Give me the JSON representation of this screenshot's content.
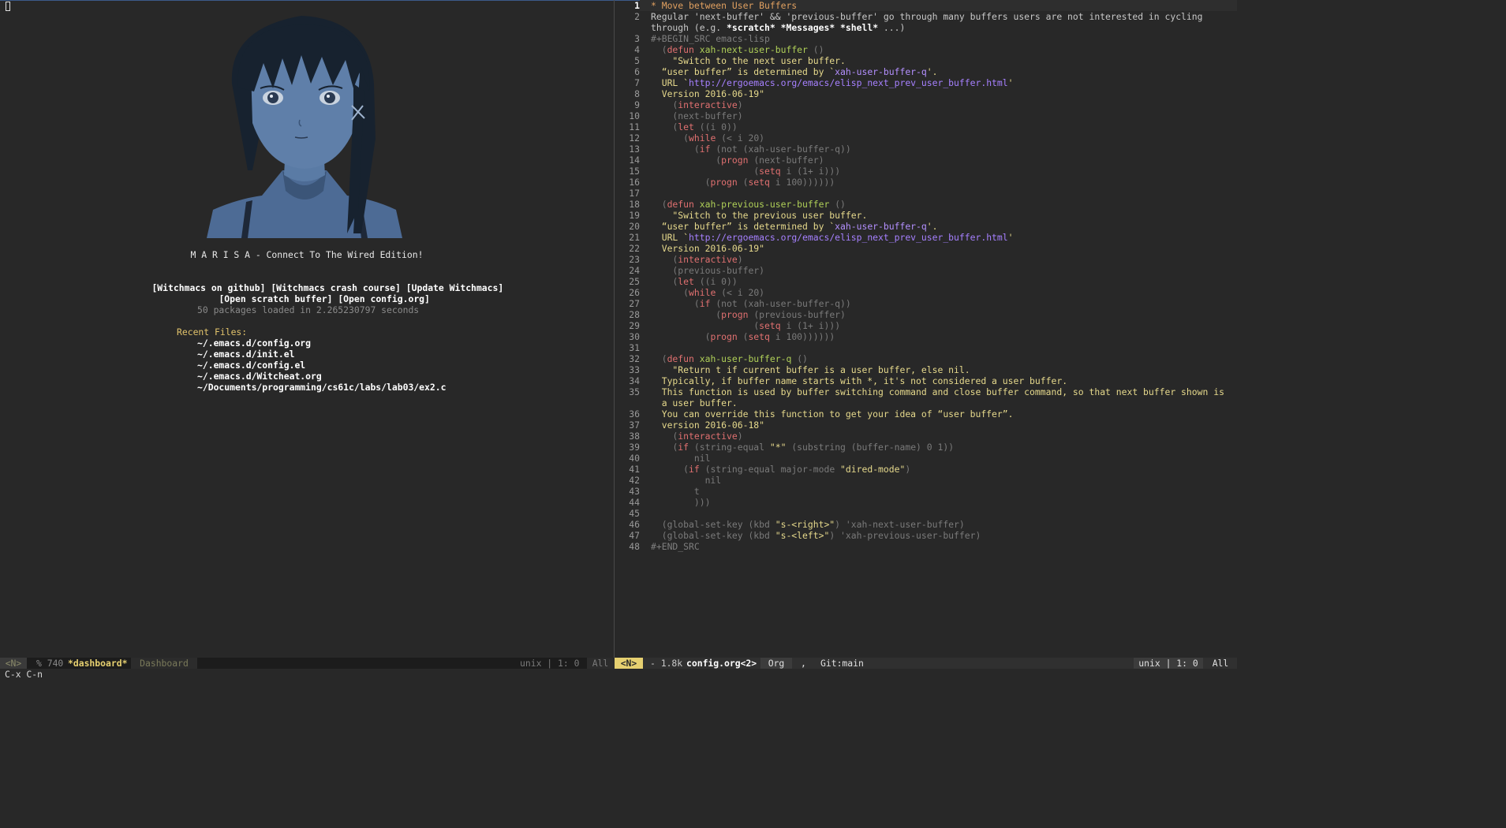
{
  "dashboard": {
    "banner_title": "M A R I S A - Connect To The Wired Edition!",
    "buttons_row1": [
      "[Witchmacs on github]",
      "[Witchmacs crash course]",
      "[Update Witchmacs]"
    ],
    "buttons_row2": [
      "[Open scratch buffer]",
      "[Open config.org]"
    ],
    "packages_loaded": "50 packages loaded in 2.265230797 seconds",
    "recent_files_heading": "Recent Files:",
    "recent_files": [
      "~/.emacs.d/config.org",
      "~/.emacs.d/init.el",
      "~/.emacs.d/config.el",
      "~/.emacs.d/Witcheat.org",
      "~/Documents/programming/cs61c/labs/lab03/ex2.c"
    ]
  },
  "editor": {
    "line_numbers": [
      "1",
      "2",
      "",
      "3",
      "4",
      "5",
      "6",
      "7",
      "8",
      "9",
      "10",
      "11",
      "12",
      "13",
      "14",
      "15",
      "16",
      "17",
      "18",
      "19",
      "20",
      "21",
      "22",
      "23",
      "24",
      "25",
      "26",
      "27",
      "28",
      "29",
      "30",
      "31",
      "32",
      "33",
      "34",
      "35",
      "",
      "36",
      "37",
      "38",
      "39",
      "40",
      "41",
      "42",
      "43",
      "44",
      "45",
      "46",
      "47",
      "48"
    ],
    "current_line": "1"
  },
  "modeline_left": {
    "state": "<N>",
    "info": "% 740",
    "buffer": "*dashboard*",
    "mode": "Dashboard",
    "encoding": "unix | 1: 0",
    "position": "All"
  },
  "modeline_right": {
    "state": "<N>",
    "size": "- 1.8k",
    "buffer": "config.org<2>",
    "mode": "Org",
    "sep": ",",
    "vcs": "Git:main",
    "encoding": "unix | 1: 0",
    "position": "All"
  },
  "echo_area": "C-x C-n",
  "colors": {
    "background": "#282828",
    "heading": "#e0a060",
    "docstring": "#e6d98c",
    "keyword": "#e07070",
    "function": "#b0d058",
    "link": "#a680ff",
    "state_badge": "#e6d070"
  }
}
